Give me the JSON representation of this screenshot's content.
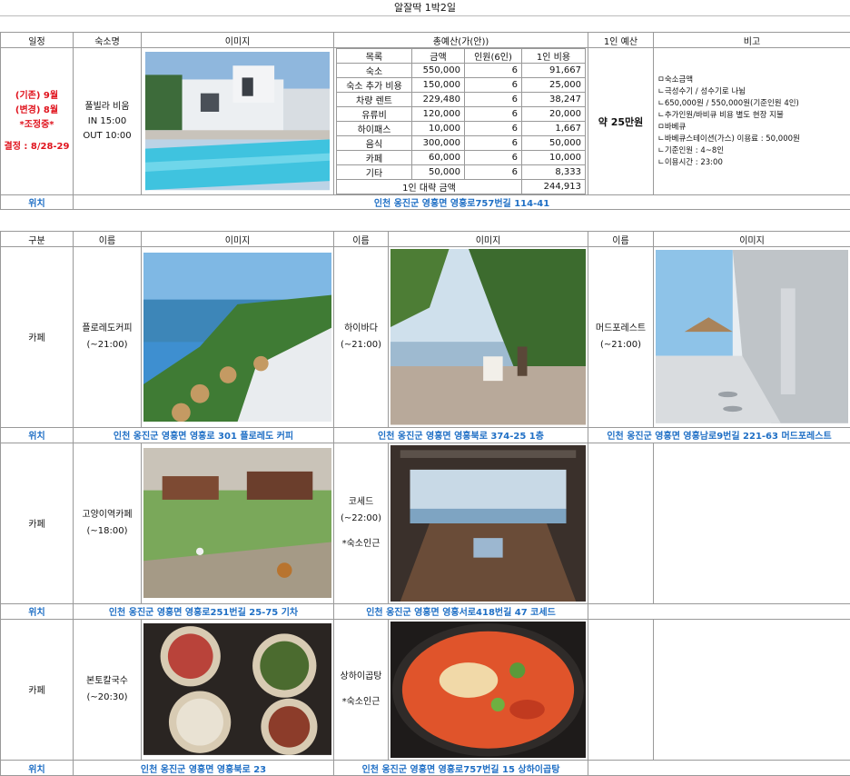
{
  "title": "알잘딱 1박2일",
  "top_headers": [
    "일정",
    "숙소명",
    "이미지",
    "총예산(가(안))",
    "1인 예산",
    "비고"
  ],
  "schedule": {
    "lines": [
      "(기존) 9월",
      "(변경) 8월",
      "*조정중*"
    ],
    "decision": "결정 : 8/28-29"
  },
  "lodging": {
    "name": "풀빌라 비움",
    "checkin": "IN 15:00",
    "checkout": "OUT 10:00",
    "image": "pool-villa-photo"
  },
  "budget": {
    "headers": [
      "목록",
      "금액",
      "인원(6인)",
      "1인 비용"
    ],
    "rows": [
      {
        "item": "숙소",
        "amount": "550,000",
        "people": "6",
        "per": "91,667"
      },
      {
        "item": "숙소 추가 비용",
        "amount": "150,000",
        "people": "6",
        "per": "25,000"
      },
      {
        "item": "차량 렌트",
        "amount": "229,480",
        "people": "6",
        "per": "38,247"
      },
      {
        "item": "유류비",
        "amount": "120,000",
        "people": "6",
        "per": "20,000"
      },
      {
        "item": "하이패스",
        "amount": "10,000",
        "people": "6",
        "per": "1,667"
      },
      {
        "item": "음식",
        "amount": "300,000",
        "people": "6",
        "per": "50,000"
      },
      {
        "item": "카페",
        "amount": "60,000",
        "people": "6",
        "per": "10,000"
      },
      {
        "item": "기타",
        "amount": "50,000",
        "people": "6",
        "per": "8,333"
      }
    ],
    "total_label": "1인 대략 금액",
    "total": "244,913"
  },
  "per_person": "약 25만원",
  "notes": [
    "ㅁ숙소금액",
    "ㄴ극성수기 / 성수기로 나뉨",
    "ㄴ650,000원 / 550,000원(기준인원 4인)",
    "ㄴ추가인원/바비큐 비용 별도 현장 지불",
    "ㅁ바베큐",
    "ㄴ바베큐스테이션(가스) 이용료 : 50,000원",
    "ㄴ기준인원 : 4~8인",
    "ㄴ이용시간 : 23:00"
  ],
  "loc_label": "위치",
  "lodging_location": "인천 옹진군 영흥면 영흥로757번길 114-41",
  "section2_headers": [
    "구분",
    "이름",
    "이미지",
    "이름",
    "이미지",
    "이름",
    "이미지"
  ],
  "rows": [
    {
      "category": "카페",
      "places": [
        {
          "name": "플로레도커피",
          "hours": "(~21:00)",
          "note": "",
          "image": "cafe-sea-photo",
          "location": "인천 옹진군 영흥면 영흥로 301 플로레도 커피"
        },
        {
          "name": "하이바다",
          "hours": "(~21:00)",
          "note": "",
          "image": "terrace-photo",
          "location": "인천 옹진군 영흥면 영흥북로 374-25 1층"
        },
        {
          "name": "머드포레스트",
          "hours": "(~21:00)",
          "note": "",
          "image": "corridor-photo",
          "location": "인천 옹진군 영흥면 영흥남로9번길 221-63 머드포레스트"
        }
      ]
    },
    {
      "category": "카페",
      "places": [
        {
          "name": "고양이역카페",
          "hours": "(~18:00)",
          "note": "",
          "image": "garden-photo",
          "location": "인천 옹진군 영흥면 영흥로251번길 25-75 기차"
        },
        {
          "name": "코세드",
          "hours": "(~22:00)",
          "note": "*숙소인근",
          "image": "interior-photo",
          "location": "인천 옹진군 영흥면 영흥서로418번길 47 코세드"
        }
      ]
    },
    {
      "category": "카페",
      "places": [
        {
          "name": "본토칼국수",
          "hours": "(~20:30)",
          "note": "",
          "image": "noodle-photo",
          "location": "인천 옹진군 영흥면 영흥북로 23"
        },
        {
          "name": "상하이곱탕",
          "hours": "",
          "note": "*숙소인근",
          "image": "stew-photo",
          "location": "인천 옹진군 영흥면 영흥로757번길 15 상하이곱탕"
        }
      ]
    }
  ]
}
